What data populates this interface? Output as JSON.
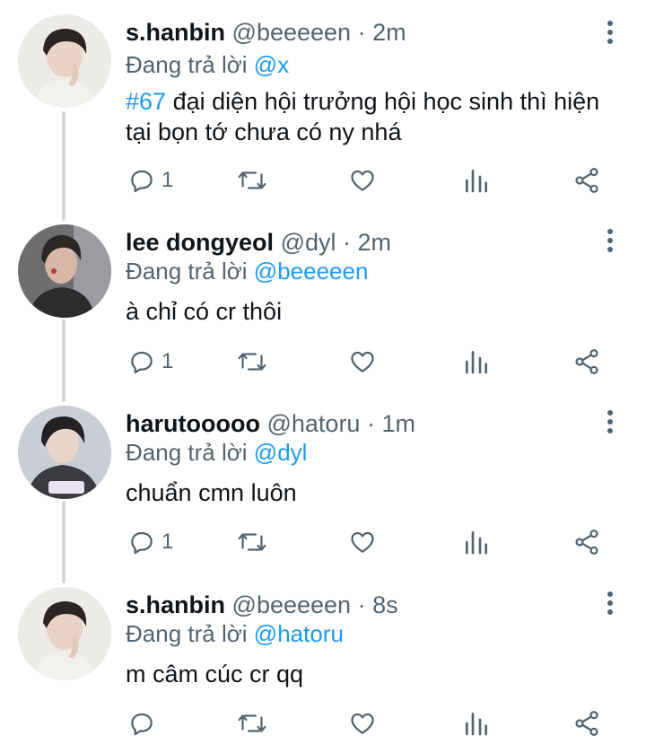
{
  "replies": [
    {
      "name": "s.hanbin",
      "handle": "@beeeeen",
      "time": "· 2m",
      "reply_prefix": "Đang trả lời",
      "reply_to": "@x",
      "hashtag": "#67",
      "text": " đại diện hội trưởng hội học sinh thì hiện tại bọn tớ chưa có ny nhá",
      "reply_count": "1",
      "avatar_icon": "avatar-photo"
    },
    {
      "name": "lee dongyeol",
      "handle": "@dyl",
      "time": "· 2m",
      "reply_prefix": "Đang trả lời",
      "reply_to": "@beeeeen",
      "text": "à chỉ có cr thôi",
      "reply_count": "1",
      "avatar_icon": "avatar-photo"
    },
    {
      "name": "harutooooo",
      "handle": "@hatoru",
      "time": "· 1m",
      "reply_prefix": "Đang trả lời",
      "reply_to": "@dyl",
      "text": "chuẩn cmn luôn",
      "reply_count": "1",
      "avatar_icon": "avatar-photo"
    },
    {
      "name": "s.hanbin",
      "handle": "@beeeeen",
      "time": "· 8s",
      "reply_prefix": "Đang trả lời",
      "reply_to": "@hatoru",
      "text": "m câm cúc cr qq",
      "reply_count": "",
      "avatar_icon": "avatar-photo"
    }
  ],
  "colors": {
    "accent": "#1d9bf0",
    "secondary_text": "#536471",
    "thread_line": "#cfd9de"
  }
}
